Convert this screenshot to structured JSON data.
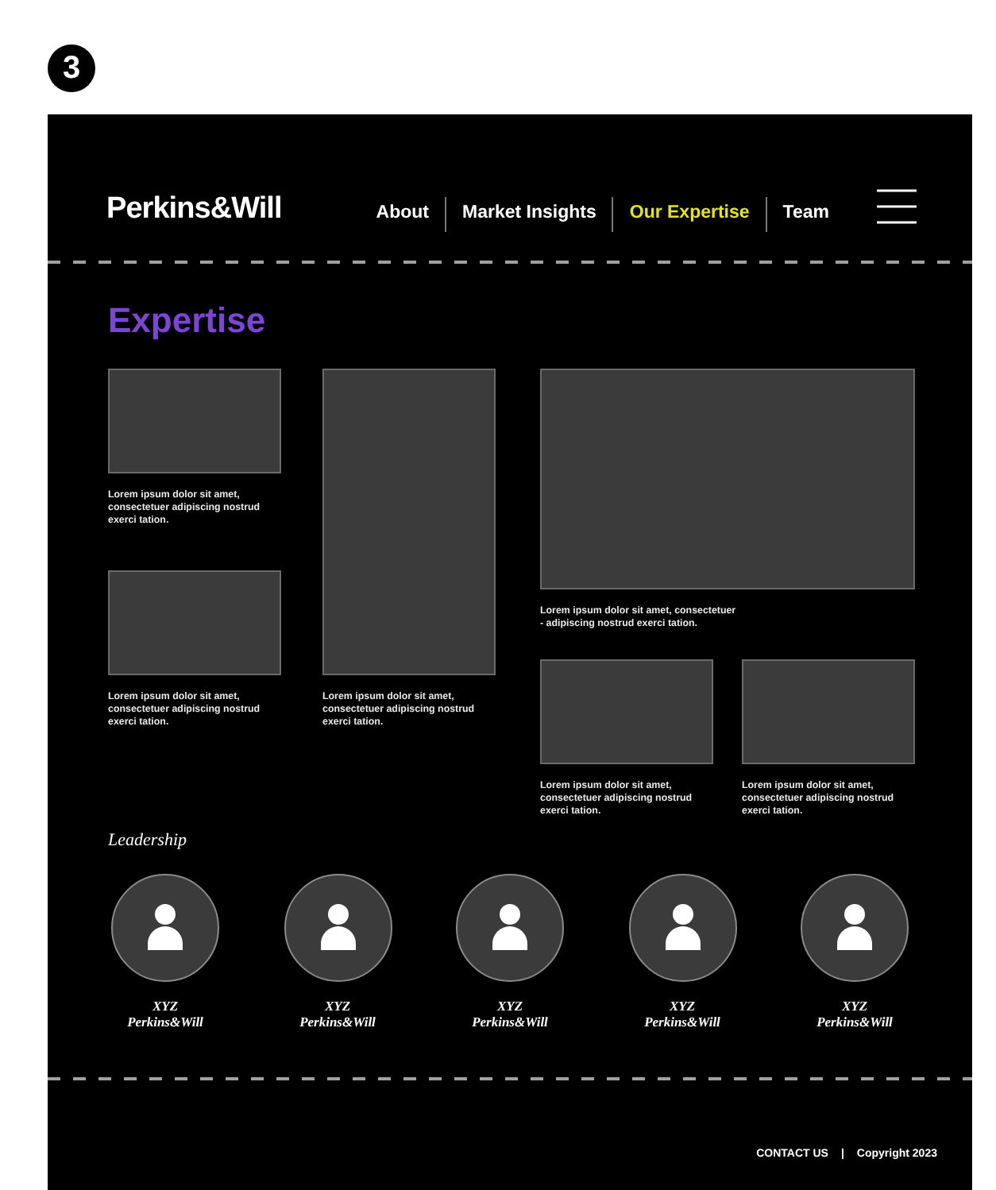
{
  "step_badge": "3",
  "header": {
    "logo": "Perkins&Will",
    "nav": [
      {
        "label": "About",
        "selected": false
      },
      {
        "label": "Market Insights",
        "selected": false
      },
      {
        "label": "Our Expertise",
        "selected": true
      },
      {
        "label": "Team",
        "selected": false
      }
    ]
  },
  "title": "Expertise",
  "cards": [
    {
      "kind": "short",
      "caption": "Lorem ipsum dolor sit amet, consectetuer adipiscing nostrud exerci tation."
    },
    {
      "kind": "short",
      "caption": "Lorem ipsum dolor sit amet, consectetuer adipiscing nostrud exerci tation."
    },
    {
      "kind": "tall",
      "caption": "Lorem ipsum dolor sit amet, consectetuer adipiscing nostrud exerci tation."
    },
    {
      "kind": "wide",
      "caption": "Lorem ipsum dolor sit amet, consectetuer\n-  adipiscing nostrud exerci tation."
    },
    {
      "kind": "short",
      "caption": "Lorem ipsum dolor sit amet, consectetuer adipiscing nostrud exerci tation."
    },
    {
      "kind": "short",
      "caption": "Lorem ipsum dolor sit amet, consectetuer adipiscing nostrud exerci tation."
    }
  ],
  "leadership": {
    "heading": "Leadership",
    "people": [
      {
        "name": "XYZ",
        "company": "Perkins&Will"
      },
      {
        "name": "XYZ",
        "company": "Perkins&Will"
      },
      {
        "name": "XYZ",
        "company": "Perkins&Will"
      },
      {
        "name": "XYZ",
        "company": "Perkins&Will"
      },
      {
        "name": "XYZ",
        "company": "Perkins&Will"
      }
    ]
  },
  "footer": {
    "contact": "CONTACT US",
    "separator": "|",
    "copyright": "Copyright 2023"
  }
}
